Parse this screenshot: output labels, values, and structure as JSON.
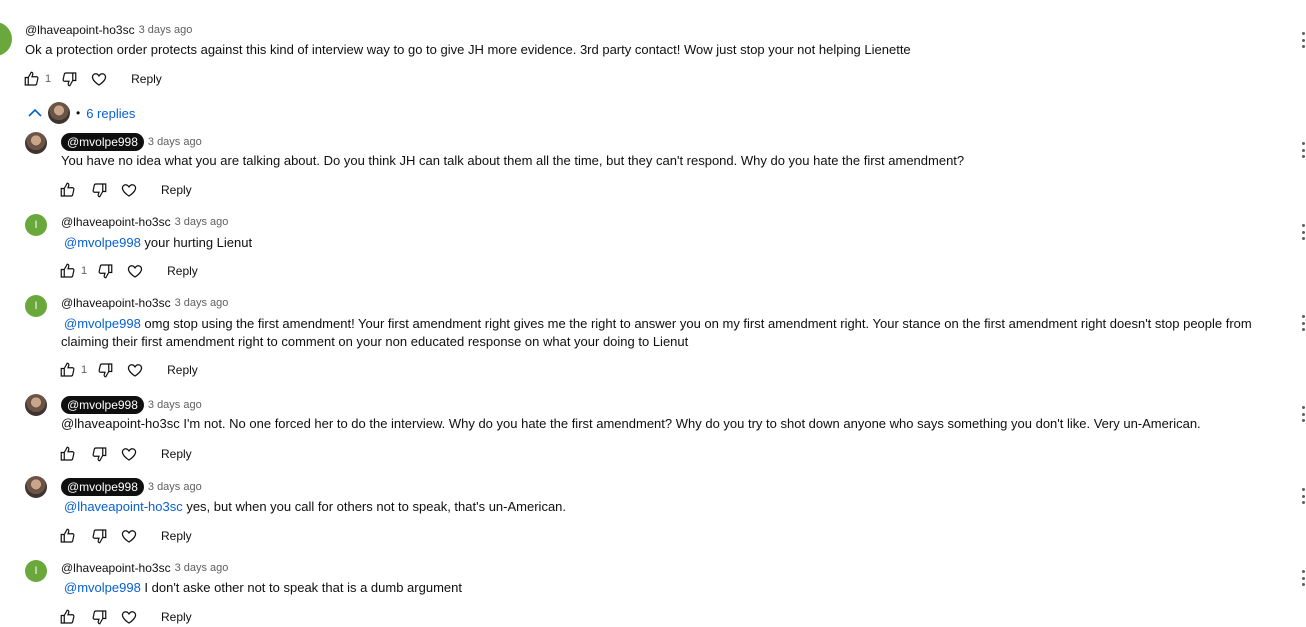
{
  "top_comment": {
    "author": "@lhaveapoint-ho3sc",
    "time": "3 days ago",
    "text": "Ok a protection order protects against this kind of interview way to go to give JH more evidence. 3rd party contact! Wow just stop your not helping Lienette",
    "likes": "1",
    "reply_label": "Reply"
  },
  "replies_toggle": {
    "label": "6 replies",
    "separator": "•"
  },
  "replies": [
    {
      "author": "@mvolpe998",
      "time": "3 days ago",
      "mention": "",
      "text": "You have no idea what you are talking about. Do you think JH can talk about them all the time, but they can't respond. Why do you hate the first amendment?",
      "likes": "",
      "reply_label": "Reply"
    },
    {
      "author": "@lhaveapoint-ho3sc",
      "time": "3 days ago",
      "mention": "@mvolpe998",
      "text": " your hurting Lienut",
      "likes": "1",
      "reply_label": "Reply"
    },
    {
      "author": "@lhaveapoint-ho3sc",
      "time": "3 days ago",
      "mention": "@mvolpe998",
      "text": " omg stop using the first amendment! Your first amendment right gives me the right to answer you on my first amendment right. Your stance on the first amendment right doesn't stop people from claiming their first amendment right to comment on your non educated response on what your doing to Lienut",
      "likes": "1",
      "reply_label": "Reply"
    },
    {
      "author": "@mvolpe998",
      "time": "3 days ago",
      "mention": "",
      "text": "@lhaveapoint-ho3sc I'm not. No one forced her to do the interview. Why do you hate the first amendment? Why do you try to shot down anyone who says something you don't like. Very un-American.",
      "likes": "",
      "reply_label": "Reply"
    },
    {
      "author": "@mvolpe998",
      "time": "3 days ago",
      "mention": "@lhaveapoint-ho3sc",
      "text": " yes, but when you call for others not to speak, that's un-American.",
      "likes": "",
      "reply_label": "Reply"
    },
    {
      "author": "@lhaveapoint-ho3sc",
      "time": "3 days ago",
      "mention": "@mvolpe998",
      "text": " I don't aske other not to speak that is a dumb argument",
      "likes": "",
      "reply_label": "Reply"
    }
  ],
  "avatar_letter": "I",
  "colors": {
    "link": "#065fd4",
    "avatar_green": "#6aa83b",
    "chip": "#0f0f0f",
    "meta": "#606060"
  }
}
